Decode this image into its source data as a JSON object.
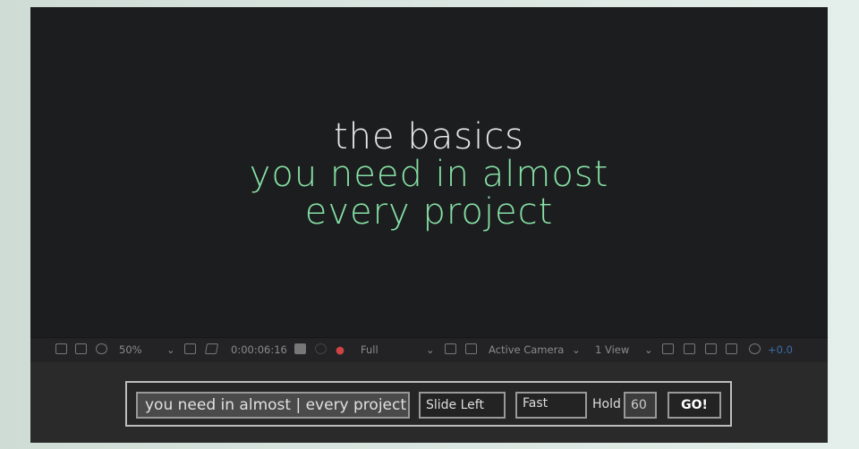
{
  "viewer": {
    "line1": "the basics",
    "line2": "you need in almost",
    "line3": "every project",
    "line1_color": "#e8e8e8",
    "accent_color": "#86e0a4"
  },
  "toolbar": {
    "zoom": "50%",
    "timecode": "0:00:06:16",
    "resolution": "Full",
    "camera": "Active Camera",
    "views": "1 View",
    "exposure": "+0.0",
    "exposure_color": "#3b6ea8"
  },
  "panel": {
    "text_value": "you need in almost | every project",
    "animation": "Slide Left",
    "speed": "Fast",
    "hold_label": "Hold",
    "hold_value": "60",
    "go_label": "GO!"
  }
}
